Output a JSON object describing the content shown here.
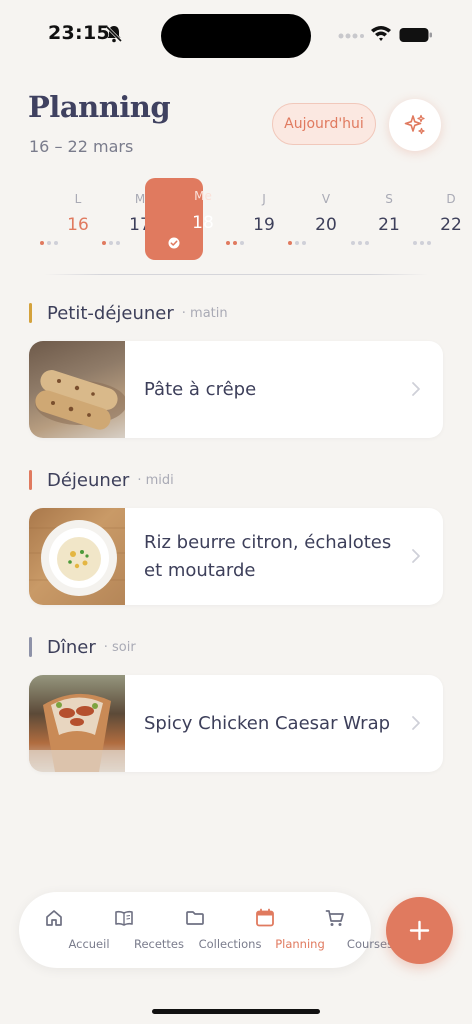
{
  "status_bar": {
    "time": "23:15"
  },
  "header": {
    "title": "Planning",
    "date_range": "16 – 22 mars",
    "today_label": "Aujourd'hui",
    "magic_icon": "sparkles-icon"
  },
  "week": {
    "days": [
      {
        "letter": "L",
        "number": "16",
        "dots": [
          1,
          0,
          0
        ],
        "state": "today"
      },
      {
        "letter": "M",
        "number": "17",
        "dots": [
          1,
          0,
          0
        ],
        "state": ""
      },
      {
        "letter": "Me",
        "number": "18",
        "dots": [],
        "state": "selected"
      },
      {
        "letter": "J",
        "number": "19",
        "dots": [
          1,
          1,
          0
        ],
        "state": ""
      },
      {
        "letter": "V",
        "number": "20",
        "dots": [
          1,
          0,
          0
        ],
        "state": ""
      },
      {
        "letter": "S",
        "number": "21",
        "dots": [
          0,
          0,
          0
        ],
        "state": ""
      },
      {
        "letter": "D",
        "number": "22",
        "dots": [
          0,
          0,
          0
        ],
        "state": ""
      }
    ]
  },
  "meals": [
    {
      "title": "Petit-déjeuner",
      "subtitle": "· matin",
      "color": "#d4a23c",
      "recipe": "Pâte à crêpe"
    },
    {
      "title": "Déjeuner",
      "subtitle": "· midi",
      "color": "#e07a5f",
      "recipe": "Riz beurre citron, échalotes et moutarde"
    },
    {
      "title": "Dîner",
      "subtitle": "· soir",
      "color": "#8e92a8",
      "recipe": "Spicy Chicken Caesar Wrap"
    }
  ],
  "nav": {
    "items": [
      {
        "label": "Accueil",
        "icon": "home-icon",
        "active": false
      },
      {
        "label": "Recettes",
        "icon": "book-icon",
        "active": false
      },
      {
        "label": "Collections",
        "icon": "folder-icon",
        "active": false
      },
      {
        "label": "Planning",
        "icon": "calendar-icon",
        "active": true
      },
      {
        "label": "Courses",
        "icon": "cart-icon",
        "active": false
      }
    ],
    "fab_icon": "plus-icon"
  },
  "colors": {
    "accent": "#e07a5f",
    "background": "#f6f4f1",
    "text": "#3d3f5a"
  }
}
